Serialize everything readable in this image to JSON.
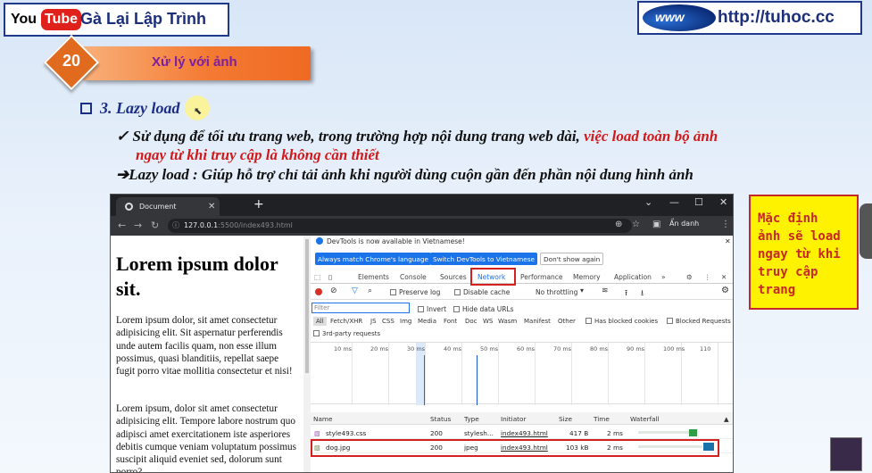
{
  "header": {
    "yt_logo_you": "You",
    "yt_logo_tube": "Tube",
    "channel": "Gà Lại Lập Trình",
    "site_logo": "www",
    "site_url": "http://tuhoc.cc"
  },
  "lesson": {
    "number": "20",
    "title": "Xử lý với ảnh"
  },
  "section": {
    "title": "3. Lazy load",
    "line1_a": "✓  Sử dụng để tối ưu trang web, trong trường hợp nội dung trang web dài, ",
    "line1_b": "việc load toàn bộ ảnh",
    "line2": "ngay từ khi truy cập là không cần thiết",
    "line3": "➔Lazy load : Giúp hỗ trợ chỉ tải ảnh khi người dùng cuộn gần đến phần nội dung hình ảnh"
  },
  "browser": {
    "tab_title": "Document",
    "url_host": "127.0.0.1",
    "url_path": ":5500/index493.html",
    "account_label": "Ẩn danh"
  },
  "page": {
    "heading": "Lorem ipsum dolor sit.",
    "para1": "Lorem ipsum dolor, sit amet consectetur adipisicing elit. Sit aspernatur perferendis unde autem facilis quam, non esse illum possimus, quasi blanditiis, repellat saepe fugit porro vitae mollitia consectetur et nisi!",
    "para2": "Lorem ipsum, dolor sit amet consectetur adipisicing elit. Tempore labore nostrum quo adipisci amet exercitationem iste asperiores debitis cumque veniam voluptatum possimus suscipit aliquid eveniet sed, dolorum sunt porro?"
  },
  "devtools": {
    "info": "DevTools is now available in Vietnamese!",
    "btn_match": "Always match Chrome's language",
    "btn_switch": "Switch DevTools to Vietnamese",
    "btn_dont": "Don't show again",
    "tabs": [
      "Elements",
      "Console",
      "Sources",
      "Network",
      "Performance",
      "Memory",
      "Application"
    ],
    "more": "»",
    "preserve_log": "Preserve log",
    "disable_cache": "Disable cache",
    "throttling": "No throttling",
    "filter_placeholder": "Filter",
    "invert": "Invert",
    "hide_data": "Hide data URLs",
    "types": [
      "All",
      "Fetch/XHR",
      "JS",
      "CSS",
      "Img",
      "Media",
      "Font",
      "Doc",
      "WS",
      "Wasm",
      "Manifest",
      "Other"
    ],
    "blocked_cookies": "Has blocked cookies",
    "blocked_requests": "Blocked Requests",
    "third_party": "3rd-party requests",
    "ticks": [
      "10 ms",
      "20 ms",
      "30 ms",
      "40 ms",
      "50 ms",
      "60 ms",
      "70 ms",
      "80 ms",
      "90 ms",
      "100 ms",
      "110"
    ],
    "columns": [
      "Name",
      "Status",
      "Type",
      "Initiator",
      "Size",
      "Time",
      "Waterfall"
    ],
    "rows": [
      {
        "name": "style493.css",
        "status": "200",
        "type": "stylesh...",
        "initiator": "index493.html",
        "size": "417 B",
        "time": "2 ms"
      },
      {
        "name": "dog.jpg",
        "status": "200",
        "type": "jpeg",
        "initiator": "index493.html",
        "size": "103 kB",
        "time": "2 ms"
      }
    ]
  },
  "note": "Mặc định\nảnh sẽ load\nngay từ khi\ntruy cập\ntrang",
  "colors": {
    "accent_red": "#d21818",
    "title_blue": "#1b2f86",
    "banner_orange": "#f47a33",
    "note_yellow": "#fff200"
  }
}
